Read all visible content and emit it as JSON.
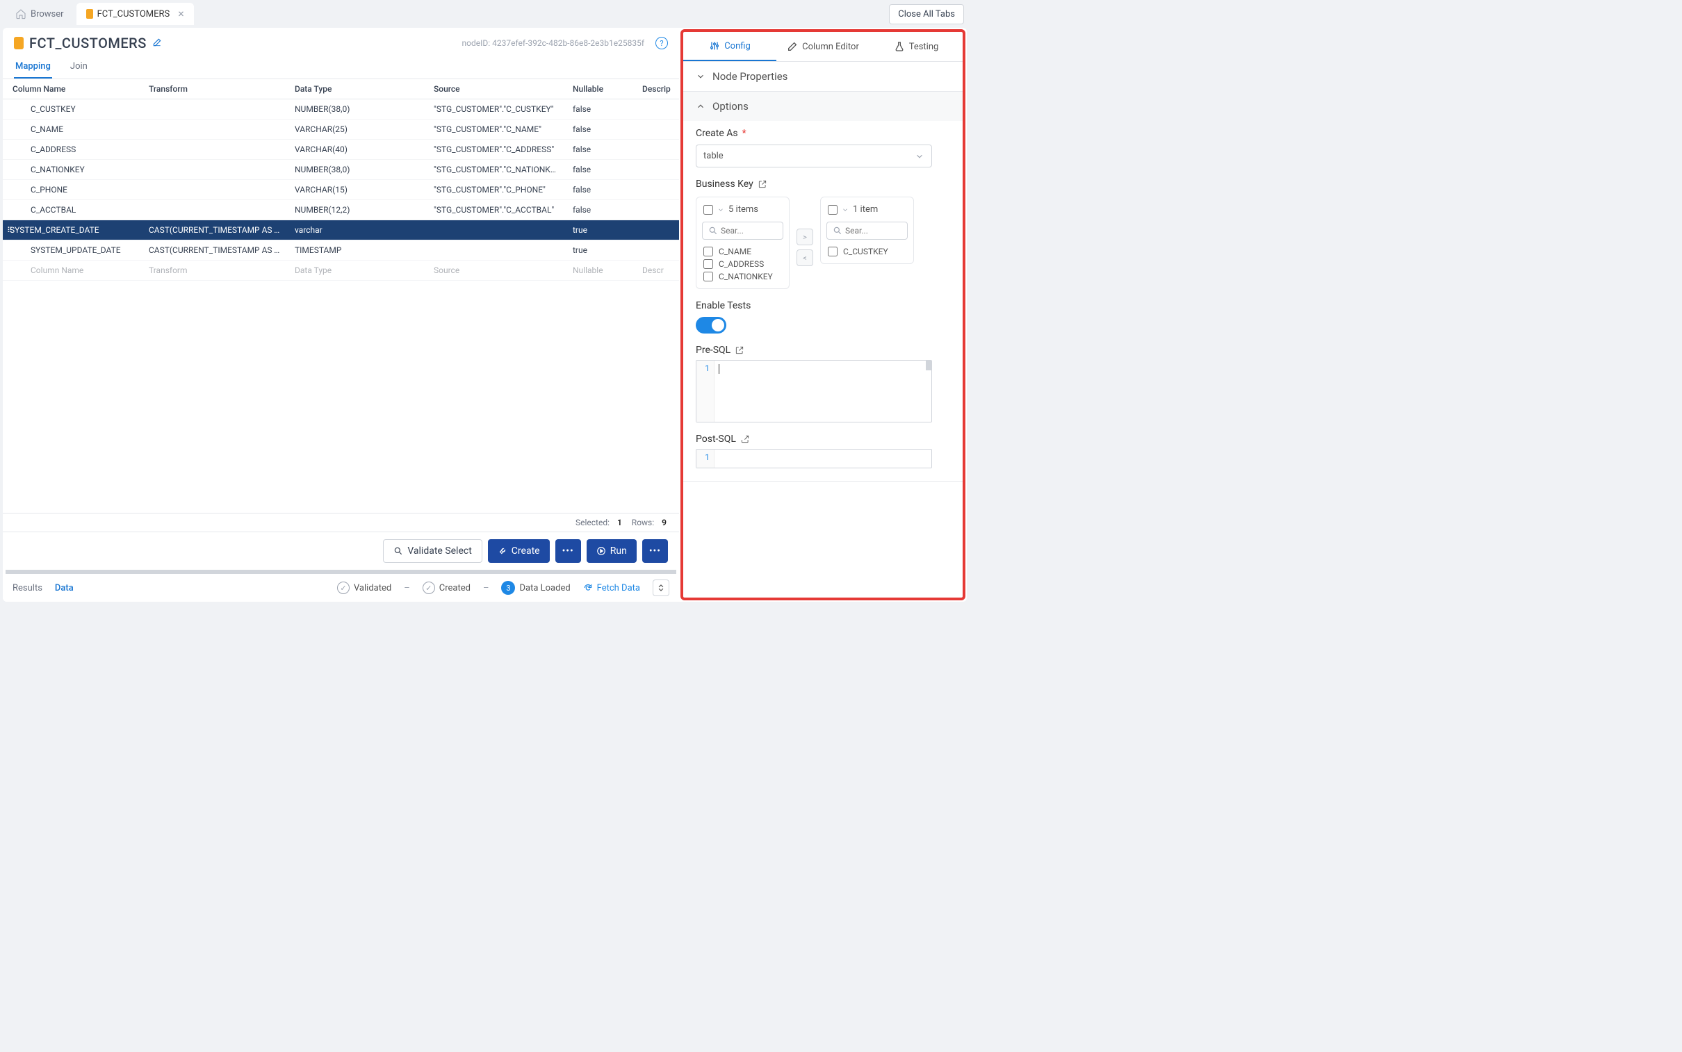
{
  "tabs": {
    "browser": "Browser",
    "active": "FCT_CUSTOMERS",
    "close_all": "Close All Tabs"
  },
  "page": {
    "title": "FCT_CUSTOMERS",
    "node_id_prefix": "nodeID:",
    "node_id": "4237efef-392c-482b-86e8-2e3b1e25835f"
  },
  "subtabs": {
    "mapping": "Mapping",
    "join": "Join"
  },
  "table": {
    "headers": {
      "name": "Column Name",
      "transform": "Transform",
      "datatype": "Data Type",
      "source": "Source",
      "nullable": "Nullable",
      "description": "Descrip"
    },
    "rows": [
      {
        "name": "C_CUSTKEY",
        "transform": "",
        "datatype": "NUMBER(38,0)",
        "source": "\"STG_CUSTOMER\".\"C_CUSTKEY\"",
        "nullable": "false"
      },
      {
        "name": "C_NAME",
        "transform": "",
        "datatype": "VARCHAR(25)",
        "source": "\"STG_CUSTOMER\".\"C_NAME\"",
        "nullable": "false"
      },
      {
        "name": "C_ADDRESS",
        "transform": "",
        "datatype": "VARCHAR(40)",
        "source": "\"STG_CUSTOMER\".\"C_ADDRESS\"",
        "nullable": "false"
      },
      {
        "name": "C_NATIONKEY",
        "transform": "",
        "datatype": "NUMBER(38,0)",
        "source": "\"STG_CUSTOMER\".\"C_NATIONKEY\"",
        "nullable": "false"
      },
      {
        "name": "C_PHONE",
        "transform": "",
        "datatype": "VARCHAR(15)",
        "source": "\"STG_CUSTOMER\".\"C_PHONE\"",
        "nullable": "false"
      },
      {
        "name": "C_ACCTBAL",
        "transform": "",
        "datatype": "NUMBER(12,2)",
        "source": "\"STG_CUSTOMER\".\"C_ACCTBAL\"",
        "nullable": "false"
      },
      {
        "name": "SYSTEM_CREATE_DATE",
        "transform": "CAST(CURRENT_TIMESTAMP AS TIM",
        "datatype": "varchar",
        "source": "",
        "nullable": "true",
        "selected": true
      },
      {
        "name": "SYSTEM_UPDATE_DATE",
        "transform": "CAST(CURRENT_TIMESTAMP AS TIM",
        "datatype": "TIMESTAMP",
        "source": "",
        "nullable": "true"
      }
    ],
    "placeholder": {
      "name": "Column Name",
      "transform": "Transform",
      "datatype": "Data Type",
      "source": "Source",
      "nullable": "Nullable",
      "description": "Descr"
    },
    "footer": {
      "selected_lbl": "Selected:",
      "selected_val": "1",
      "rows_lbl": "Rows:",
      "rows_val": "9"
    }
  },
  "actions": {
    "validate": "Validate Select",
    "create": "Create",
    "run": "Run"
  },
  "status": {
    "results_tab": "Results",
    "data_tab": "Data",
    "validated": "Validated",
    "created": "Created",
    "loaded_num": "3",
    "loaded": "Data Loaded",
    "fetch": "Fetch Data"
  },
  "right": {
    "tabs": {
      "config": "Config",
      "column_editor": "Column Editor",
      "testing": "Testing"
    },
    "section_node_props": "Node Properties",
    "section_options": "Options",
    "create_as_label": "Create As",
    "create_as_value": "table",
    "business_key_label": "Business Key",
    "left_list_count": "5 items",
    "right_list_count": "1 item",
    "search_ph": "Sear...",
    "left_items": [
      "C_NAME",
      "C_ADDRESS",
      "C_NATIONKEY"
    ],
    "right_items": [
      "C_CUSTKEY"
    ],
    "enable_tests": "Enable Tests",
    "pre_sql": "Pre-SQL",
    "post_sql": "Post-SQL",
    "line_num": "1"
  }
}
